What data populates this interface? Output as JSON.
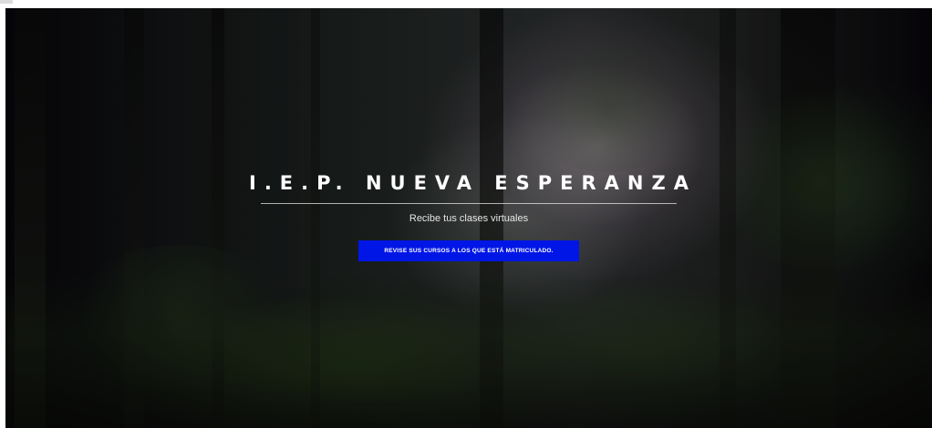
{
  "hero": {
    "title": "I.E.P. NUEVA ESPERANZA",
    "subtitle": "Recibe tus clases virtuales",
    "button_label": "REVISE SUS CURSOS A LOS QUE ESTÁ MATRICULADO."
  },
  "colors": {
    "button_background": "#0016e6",
    "title_text": "#ffffff"
  }
}
